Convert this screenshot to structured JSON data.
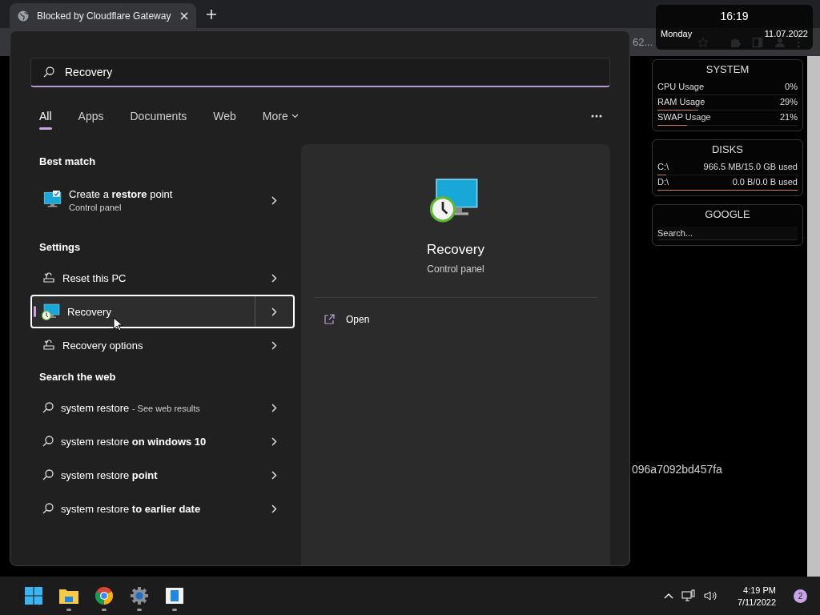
{
  "browser": {
    "tab": {
      "title": "Blocked by Cloudflare Gateway"
    },
    "address_fragment": "62...",
    "page_text": "096a7092bd457fa"
  },
  "clock_widget": {
    "time": "16:19",
    "day": "Monday",
    "date": "11.07.2022"
  },
  "widgets": [
    {
      "title": "SYSTEM",
      "rows": [
        {
          "label": "CPU Usage",
          "value": "0%",
          "level": 0
        },
        {
          "label": "RAM Usage",
          "value": "29%",
          "level": 0.29
        },
        {
          "label": "SWAP Usage",
          "value": "21%",
          "level": 0.21
        }
      ]
    },
    {
      "title": "DISKS",
      "rows": [
        {
          "label": "C:\\",
          "value": "966.5 MB/15.0 GB used",
          "level": 0.06
        },
        {
          "label": "D:\\",
          "value": "0.0 B/0.0 B used",
          "level": 1
        }
      ]
    },
    {
      "title": "GOOGLE",
      "search": {
        "placeholder": "Search..."
      }
    }
  ],
  "search_panel": {
    "query": "Recovery",
    "tabs": [
      {
        "label": "All",
        "selected": true,
        "dropdown": false
      },
      {
        "label": "Apps",
        "selected": false,
        "dropdown": false
      },
      {
        "label": "Documents",
        "selected": false,
        "dropdown": false
      },
      {
        "label": "Web",
        "selected": false,
        "dropdown": false
      },
      {
        "label": "More",
        "selected": false,
        "dropdown": true
      }
    ],
    "sections": [
      {
        "heading": "Best match",
        "items": [
          {
            "kind": "restore_point",
            "title": "Create a **restore** point",
            "subtitle": "Control panel",
            "selected": false
          }
        ]
      },
      {
        "heading": "Settings",
        "items": [
          {
            "kind": "reset",
            "title": "Reset this PC",
            "selected": false
          },
          {
            "kind": "recovery",
            "title": "Recovery",
            "selected": true
          },
          {
            "kind": "reset",
            "title": "Recovery options",
            "selected": false
          }
        ]
      },
      {
        "heading": "Search the web",
        "items": [
          {
            "kind": "web",
            "title": "system restore",
            "note": "- See web results",
            "selected": false
          },
          {
            "kind": "web",
            "title": "system restore **on windows 10**",
            "selected": false
          },
          {
            "kind": "web",
            "title": "system restore **point**",
            "selected": false
          },
          {
            "kind": "web",
            "title": "system restore **to earlier date**",
            "selected": false
          }
        ]
      }
    ],
    "preview": {
      "title": "Recovery",
      "subtitle": "Control panel",
      "actions": [
        {
          "label": "Open"
        }
      ]
    }
  },
  "taskbar": {
    "apps": [
      {
        "kind": "start",
        "running": false
      },
      {
        "kind": "explorer",
        "running": true
      },
      {
        "kind": "chrome",
        "running": true
      },
      {
        "kind": "settings",
        "running": true
      },
      {
        "kind": "window",
        "running": true
      }
    ],
    "time": "4:19 PM",
    "date": "7/11/2022",
    "notifications": "2"
  }
}
